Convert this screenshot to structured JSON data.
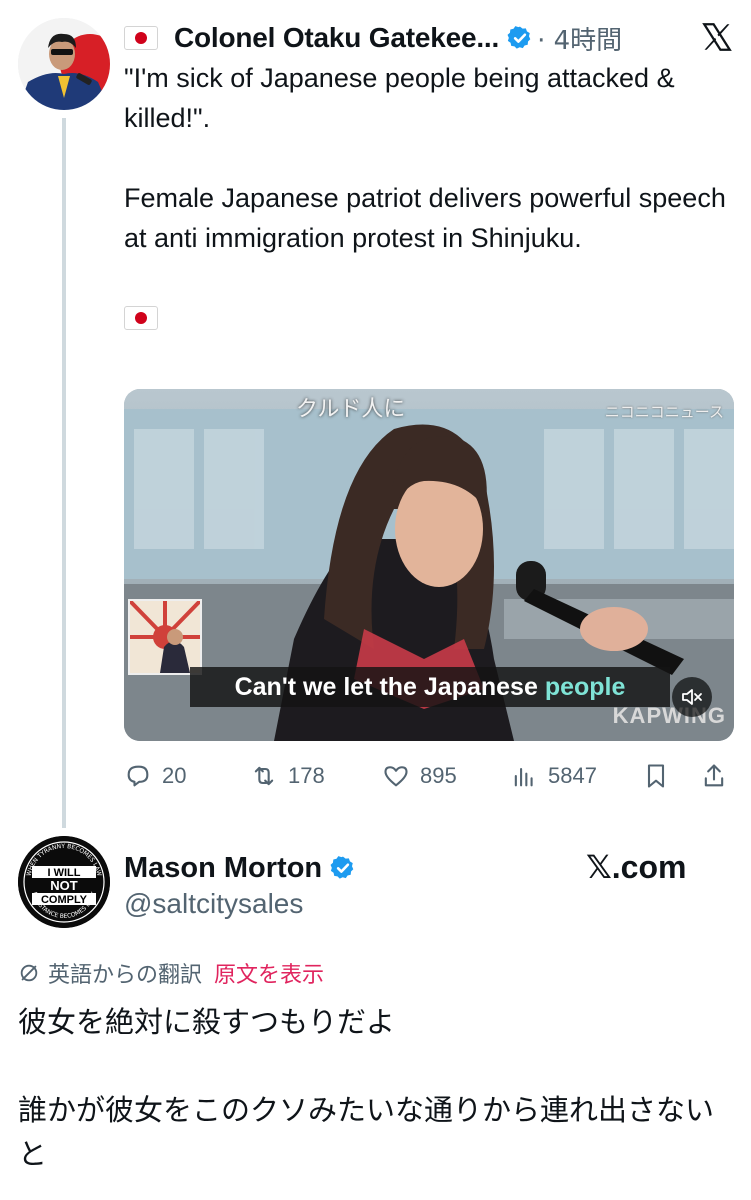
{
  "tweet": {
    "author_name": "Colonel Otaku Gatekee...",
    "author_flag_icon": "japan-flag-icon",
    "time": "· 4時間",
    "text_lines": [
      "\"I'm sick of Japanese people being attacked & killed!\".",
      "Female Japanese patriot delivers powerful speech at anti immigration protest in Shinjuku."
    ],
    "trailing_flag_icon": "japan-flag-icon",
    "video": {
      "top_caption": "クルド人に",
      "watermark": "ニコニコニュース",
      "subtitle_prefix": "Can't we let the Japanese ",
      "subtitle_highlight": "people",
      "brand": "KAPWING",
      "highlight_color": "#7fe3d6"
    },
    "actions": {
      "replies": "20",
      "reposts": "178",
      "likes": "895",
      "views": "5847"
    }
  },
  "quote": {
    "name": "Mason Morton",
    "handle": "@saltcitysales",
    "avatar_text": {
      "top": "WHEN TYRANNY BECOMES LAW",
      "main": [
        "I WILL",
        "NOT",
        "COMPLY"
      ],
      "bottom": "RESISTANCE BECOMES DUTY"
    },
    "site": "𝕏.com",
    "translated_from": "英語からの翻訳",
    "show_original": "原文を表示",
    "text_line1": "彼女を絶対に殺すつもりだよ",
    "text_line2": "誰かが彼女をこのクソみたいな通りから連れ出さないと"
  },
  "colors": {
    "verified": "#1d9bf0",
    "secondary": "#536471",
    "link_pink": "#e0245e",
    "thread_line": "#cfd9de"
  }
}
